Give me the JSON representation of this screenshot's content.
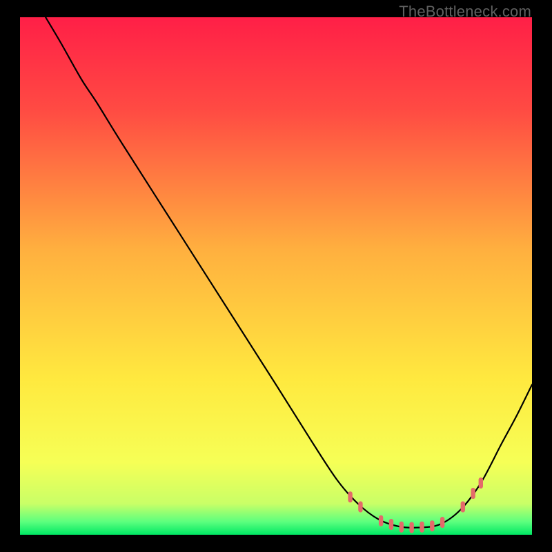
{
  "watermark": "TheBottleneck.com",
  "chart_data": {
    "type": "line",
    "title": "",
    "xlabel": "",
    "ylabel": "",
    "xlim": [
      0,
      100
    ],
    "ylim": [
      0,
      100
    ],
    "gradient_stops": [
      {
        "offset": 0.0,
        "color": "#ff1f47"
      },
      {
        "offset": 0.18,
        "color": "#ff4b43"
      },
      {
        "offset": 0.45,
        "color": "#ffb03f"
      },
      {
        "offset": 0.7,
        "color": "#ffe93f"
      },
      {
        "offset": 0.86,
        "color": "#f6ff56"
      },
      {
        "offset": 0.94,
        "color": "#c9ff67"
      },
      {
        "offset": 0.975,
        "color": "#5cff7e"
      },
      {
        "offset": 1.0,
        "color": "#00e864"
      }
    ],
    "curve": [
      {
        "x": 5.0,
        "y": 100.0
      },
      {
        "x": 8.0,
        "y": 95.0
      },
      {
        "x": 12.0,
        "y": 88.0
      },
      {
        "x": 15.0,
        "y": 83.5
      },
      {
        "x": 20.0,
        "y": 75.5
      },
      {
        "x": 30.0,
        "y": 60.0
      },
      {
        "x": 40.0,
        "y": 44.5
      },
      {
        "x": 50.0,
        "y": 29.0
      },
      {
        "x": 57.0,
        "y": 18.0
      },
      {
        "x": 62.0,
        "y": 10.5
      },
      {
        "x": 66.0,
        "y": 6.0
      },
      {
        "x": 70.0,
        "y": 3.0
      },
      {
        "x": 74.0,
        "y": 1.6
      },
      {
        "x": 78.0,
        "y": 1.4
      },
      {
        "x": 82.0,
        "y": 2.0
      },
      {
        "x": 86.0,
        "y": 4.8
      },
      {
        "x": 90.0,
        "y": 10.0
      },
      {
        "x": 94.0,
        "y": 17.5
      },
      {
        "x": 97.0,
        "y": 23.0
      },
      {
        "x": 100.0,
        "y": 29.0
      }
    ],
    "markers": [
      {
        "x": 64.5,
        "y": 7.3
      },
      {
        "x": 66.5,
        "y": 5.4
      },
      {
        "x": 70.5,
        "y": 2.7
      },
      {
        "x": 72.5,
        "y": 2.0
      },
      {
        "x": 74.5,
        "y": 1.5
      },
      {
        "x": 76.5,
        "y": 1.4
      },
      {
        "x": 78.5,
        "y": 1.5
      },
      {
        "x": 80.5,
        "y": 1.7
      },
      {
        "x": 82.5,
        "y": 2.4
      },
      {
        "x": 86.5,
        "y": 5.4
      },
      {
        "x": 88.5,
        "y": 8.0
      },
      {
        "x": 90.0,
        "y": 10.0
      }
    ],
    "marker_color": "#e46a6a"
  }
}
